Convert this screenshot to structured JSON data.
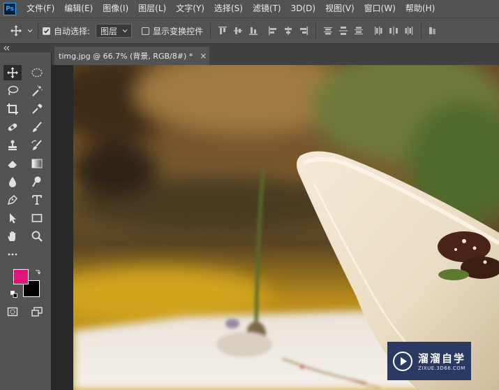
{
  "app": {
    "logo_text": "Ps"
  },
  "menu": {
    "items": [
      "文件(F)",
      "编辑(E)",
      "图像(I)",
      "图层(L)",
      "文字(Y)",
      "选择(S)",
      "滤镜(T)",
      "3D(D)",
      "视图(V)",
      "窗口(W)",
      "帮助(H)"
    ]
  },
  "options": {
    "auto_select_label": "自动选择:",
    "auto_select_checked": true,
    "layer_select_value": "图层",
    "show_transform_label": "显示变换控件",
    "show_transform_checked": false
  },
  "document": {
    "tab_title": "timg.jpg @ 66.7% (背景, RGB/8#) *",
    "close_glyph": "×"
  },
  "colors": {
    "foreground": "#e0157a",
    "background": "#000000",
    "ui_bg": "#535353",
    "ui_dark": "#414141",
    "watermark_bg": "#2b3a63"
  },
  "tools": [
    "move-tool",
    "marquee-tool",
    "lasso-tool",
    "magic-wand-tool",
    "crop-tool",
    "eyedropper-tool",
    "healing-brush-tool",
    "brush-tool",
    "clone-stamp-tool",
    "history-brush-tool",
    "eraser-tool",
    "gradient-tool",
    "blur-tool",
    "dodge-tool",
    "pen-tool",
    "type-tool",
    "path-selection-tool",
    "rectangle-tool",
    "hand-tool",
    "zoom-tool",
    "more-tools",
    "quick-mask-tool",
    "screen-mode-tool"
  ],
  "watermark": {
    "title": "溜溜自学",
    "url": "ZIXUE.3D66.COM"
  }
}
